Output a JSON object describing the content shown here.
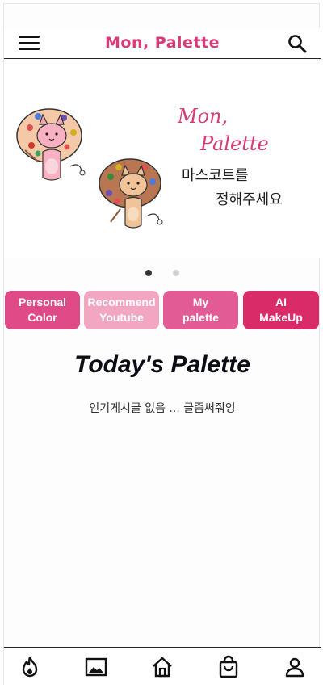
{
  "header": {
    "title": "Mon, Palette",
    "menu_icon": "hamburger-menu-icon",
    "search_icon": "search-icon"
  },
  "banner": {
    "title_line1": "Mon,",
    "title_line2": "Palette",
    "subtitle_line1": "마스코트를",
    "subtitle_line2": "정해주세요",
    "active_slide": 1,
    "slide_count": 2
  },
  "quick_actions": [
    {
      "label": "Personal\nColor",
      "color": "#e04a86"
    },
    {
      "label": "Recommend\nYoutube",
      "color": "#f2a6c2"
    },
    {
      "label": "My\npalette",
      "color": "#e35b94"
    },
    {
      "label": "AI\nMakeUp",
      "color": "#d92b68"
    }
  ],
  "today": {
    "title": "Today's Palette",
    "empty_message": "인기게시글 없음 ... 글좀써줘잉"
  },
  "bottom_nav": [
    {
      "icon": "fire-icon"
    },
    {
      "icon": "image-icon"
    },
    {
      "icon": "home-icon"
    },
    {
      "icon": "shopping-bag-icon"
    },
    {
      "icon": "user-icon"
    }
  ],
  "colors": {
    "brand": "#d93a78"
  }
}
